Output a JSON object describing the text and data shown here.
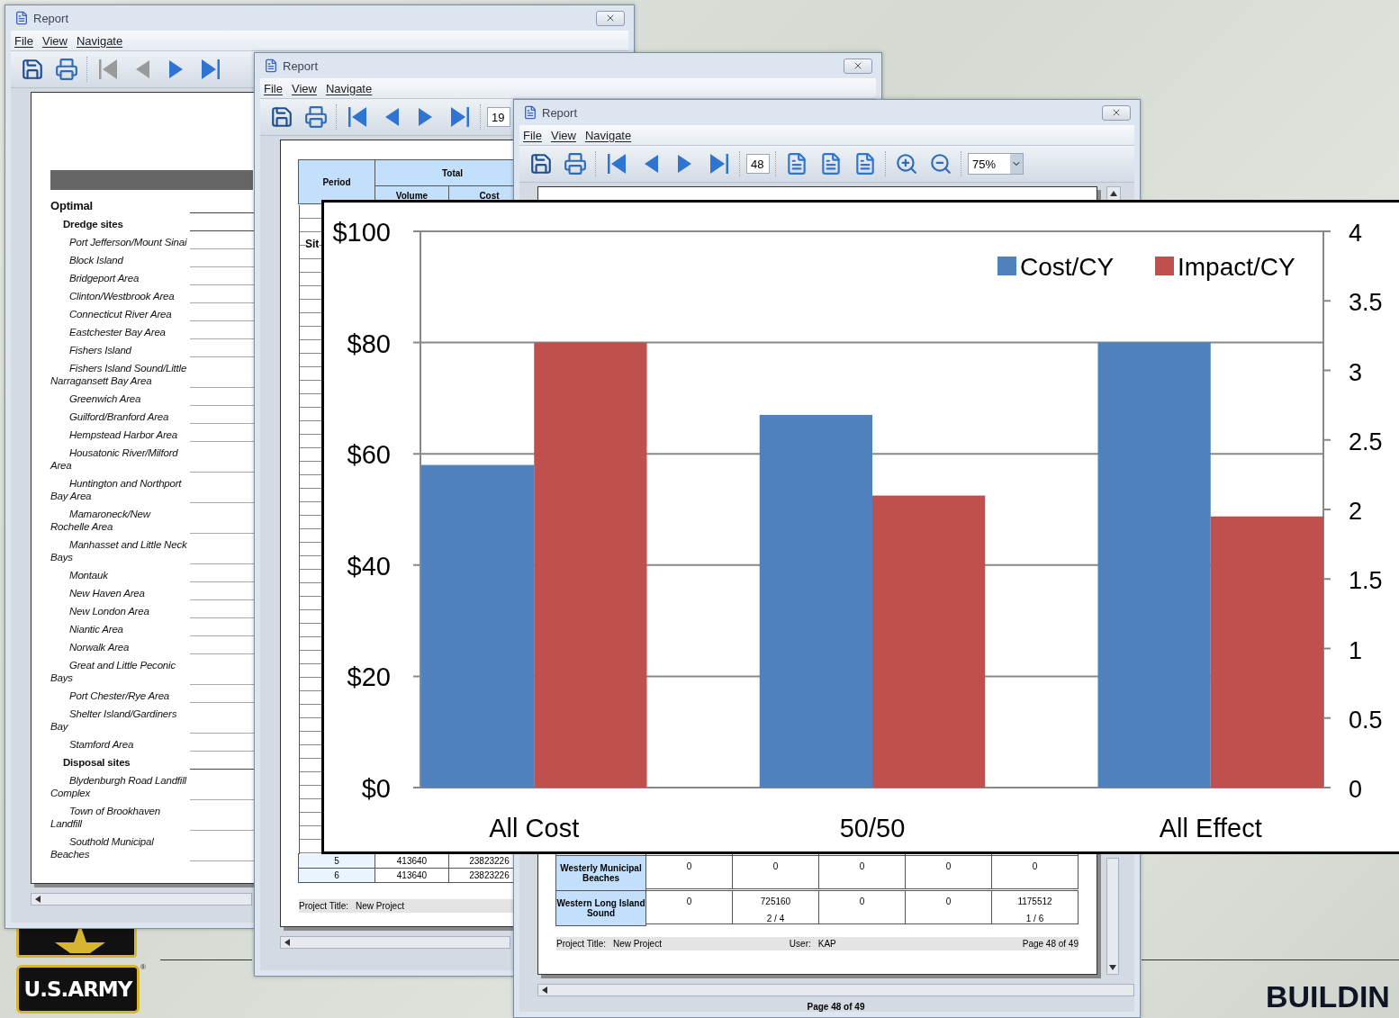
{
  "windows": [
    {
      "title": "Report",
      "menu": [
        "File",
        "View",
        "Navigate"
      ],
      "tools": [
        {
          "kind": "save",
          "disabled": false
        },
        {
          "kind": "print",
          "disabled": false
        },
        {
          "kind": "first",
          "disabled": true
        },
        {
          "kind": "prev",
          "disabled": true
        },
        {
          "kind": "next",
          "disabled": false
        },
        {
          "kind": "last",
          "disabled": false
        }
      ],
      "outline": [
        {
          "label": "Optimal",
          "children": [
            {
              "label": "Dredge sites",
              "children": [
                {
                  "label": "Port Jefferson/Mount Sinai"
                },
                {
                  "label": "Block Island"
                },
                {
                  "label": "Bridgeport Area"
                },
                {
                  "label": "Clinton/Westbrook Area"
                },
                {
                  "label": "Connecticut River Area"
                },
                {
                  "label": "Eastchester Bay Area"
                },
                {
                  "label": "Fishers Island"
                },
                {
                  "label": "Fishers Island Sound/Little Narragansett Bay Area"
                },
                {
                  "label": "Greenwich Area"
                },
                {
                  "label": "Guilford/Branford Area"
                },
                {
                  "label": "Hempstead Harbor Area"
                },
                {
                  "label": "Housatonic River/Milford Area"
                },
                {
                  "label": "Huntington and Northport Bay Area"
                },
                {
                  "label": "Mamaroneck/New Rochelle Area"
                },
                {
                  "label": "Manhasset and Little Neck Bays"
                },
                {
                  "label": "Montauk"
                },
                {
                  "label": "New Haven Area"
                },
                {
                  "label": "New London Area"
                },
                {
                  "label": "Niantic Area"
                },
                {
                  "label": "Norwalk Area"
                },
                {
                  "label": "Great and Little Peconic Bays"
                },
                {
                  "label": "Port Chester/Rye Area"
                },
                {
                  "label": "Shelter Island/Gardiners Bay"
                },
                {
                  "label": "Stamford Area"
                }
              ]
            },
            {
              "label": "Disposal sites",
              "children": [
                {
                  "label": "Blydenburgh Road Landfill Complex"
                },
                {
                  "label": "Town of Brookhaven Landfill"
                },
                {
                  "label": "Southold Municipal Beaches"
                }
              ]
            }
          ]
        }
      ]
    },
    {
      "title": "Report",
      "menu": [
        "File",
        "View",
        "Navigate"
      ],
      "tools": [
        {
          "kind": "save",
          "disabled": false
        },
        {
          "kind": "print",
          "disabled": false
        },
        {
          "kind": "first",
          "disabled": false
        },
        {
          "kind": "prev",
          "disabled": false
        },
        {
          "kind": "next",
          "disabled": false
        },
        {
          "kind": "last",
          "disabled": false
        },
        {
          "kind": "page",
          "value": "19"
        }
      ],
      "table": {
        "column_1": "Period",
        "group": "Total",
        "subcolumns": [
          "Volume",
          "Cost"
        ],
        "partial_label": "Sit",
        "rows": [
          [
            "5",
            "413640",
            "23823226"
          ],
          [
            "6",
            "413640",
            "23823226"
          ]
        ]
      },
      "footer": {
        "project_label": "Project Title:",
        "project": "New Project"
      }
    },
    {
      "title": "Report",
      "menu": [
        "File",
        "View",
        "Navigate"
      ],
      "tools": [
        {
          "kind": "save",
          "disabled": false
        },
        {
          "kind": "print",
          "disabled": false
        },
        {
          "kind": "first",
          "disabled": false
        },
        {
          "kind": "prev",
          "disabled": false
        },
        {
          "kind": "next",
          "disabled": false
        },
        {
          "kind": "last",
          "disabled": false
        },
        {
          "kind": "page",
          "value": "48"
        },
        {
          "kind": "single-page",
          "disabled": false
        },
        {
          "kind": "continuous",
          "disabled": false
        },
        {
          "kind": "facing",
          "disabled": false
        },
        {
          "kind": "zoom-in",
          "disabled": false
        },
        {
          "kind": "zoom-out",
          "disabled": false
        },
        {
          "kind": "zoom",
          "value": "75%"
        }
      ],
      "table": {
        "rows": [
          {
            "site": "Westerly Municipal Beaches",
            "cells": [
              [
                "0"
              ],
              [
                "0"
              ],
              [
                "0"
              ],
              [
                "0"
              ],
              [
                "0"
              ]
            ]
          },
          {
            "site": "Western Long Island Sound",
            "cells": [
              [
                "0"
              ],
              [
                "725160",
                "2 / 4"
              ],
              [
                "0"
              ],
              [
                "0"
              ],
              [
                "1175512",
                "1 / 6"
              ]
            ]
          }
        ]
      },
      "footer": {
        "project_label": "Project Title:",
        "project": "New Project",
        "user_label": "User:",
        "user": "KAP",
        "page": "Page 48 of 49"
      },
      "status_bar": "Page 48 of 49"
    }
  ],
  "chart": {
    "chart_data": {
      "type": "bar",
      "grid": true,
      "categories": [
        "All Cost",
        "50/50",
        "All Effect"
      ],
      "series": [
        {
          "name": "Cost/CY",
          "color": "#4f81bd",
          "values": [
            58,
            67,
            80
          ]
        },
        {
          "name": "Impact/CY",
          "color": "#c0504d",
          "axis": "y2",
          "values": [
            3.2,
            2.1,
            1.95
          ]
        }
      ],
      "legend": "top-right",
      "ylim": [
        0,
        100
      ],
      "yticks": [
        {
          "value": 0,
          "label": "$0"
        },
        {
          "value": 20,
          "label": "$20"
        },
        {
          "value": 40,
          "label": "$40"
        },
        {
          "value": 60,
          "label": "$60"
        },
        {
          "value": 80,
          "label": "$80"
        },
        {
          "value": 100,
          "label": "$100"
        }
      ],
      "y2lim": [
        0,
        4
      ],
      "y2ticks": [
        {
          "value": 0,
          "label": "0"
        },
        {
          "value": 0.5,
          "label": "0.5"
        },
        {
          "value": 1,
          "label": "1"
        },
        {
          "value": 1.5,
          "label": "1.5"
        },
        {
          "value": 2,
          "label": "2"
        },
        {
          "value": 2.5,
          "label": "2.5"
        },
        {
          "value": 3,
          "label": "3"
        },
        {
          "value": 3.5,
          "label": "3.5"
        },
        {
          "value": 4,
          "label": "4"
        }
      ]
    }
  },
  "logo": {
    "text": "U.S.ARMY",
    "mark": "®"
  },
  "heading": "BUILDIN"
}
